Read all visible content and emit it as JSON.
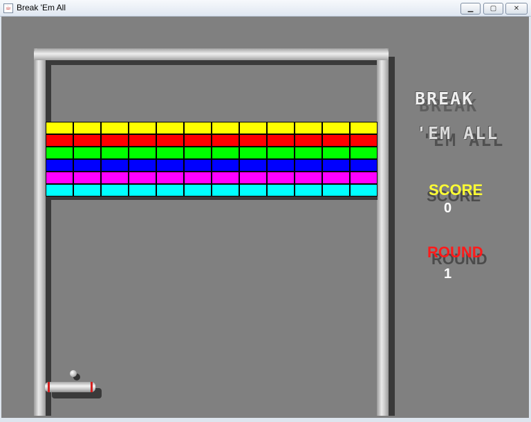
{
  "window": {
    "title": "Break 'Em All",
    "icon": "java-cup-icon",
    "buttons": {
      "minimize": "minimize-icon",
      "maximize": "maximize-icon",
      "close": "close-icon"
    }
  },
  "logo": {
    "line1": "BREAK",
    "line2": "'EM ALL"
  },
  "hud": {
    "score_label": "SCORE",
    "score_value": "0",
    "round_label": "ROUND",
    "round_value": "1"
  },
  "bricks": {
    "columns": 12,
    "rows": [
      {
        "color": "#ffff00"
      },
      {
        "color": "#ff0000"
      },
      {
        "color": "#00ff00"
      },
      {
        "color": "#0000ff"
      },
      {
        "color": "#ff00ff"
      },
      {
        "color": "#00ffff"
      }
    ]
  },
  "colors": {
    "background": "#808080",
    "score_label": "#ffff33",
    "round_label": "#ff1a1a",
    "value_text": "#ffffff",
    "paddle_tip": "#d42020"
  }
}
